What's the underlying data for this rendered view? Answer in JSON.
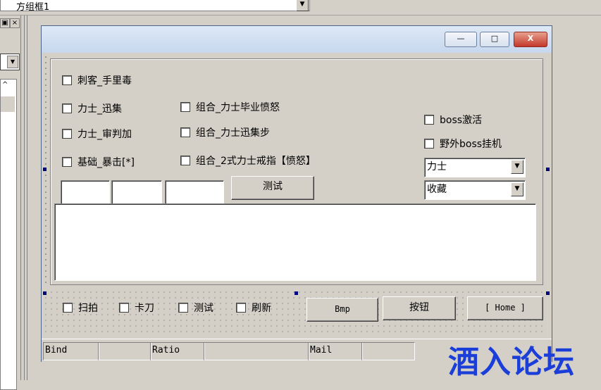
{
  "top_combo": {
    "value": "方组框1"
  },
  "left_panel": {
    "close_label": "×",
    "pin_label": "口"
  },
  "dialog": {
    "title_buttons": {
      "minimize": "—",
      "maximize": "□",
      "close": "X"
    },
    "checkboxes_col1": [
      "刺客_手里毒",
      "力士_迅集",
      "力士_审判加",
      "基础_暴击[*]"
    ],
    "checkboxes_col2": [
      "组合_力士毕业愤怒",
      "组合_力士迅集步",
      "组合_2式力士戒指【愤怒】"
    ],
    "checkboxes_right": [
      "boss激活",
      "野外boss挂机"
    ],
    "test_button": "测试",
    "select_class": "力士",
    "select_fav": "收藏",
    "bottom_checks": [
      "扫拍",
      "卡刀",
      "测试",
      "刷新"
    ],
    "btn_bmp": "Bmp",
    "btn_anniu": "按钮",
    "btn_home": "[ Home ]",
    "status": [
      "Bind",
      "",
      "Ratio",
      "",
      "Mail",
      ""
    ]
  },
  "watermark": "酒入论坛"
}
